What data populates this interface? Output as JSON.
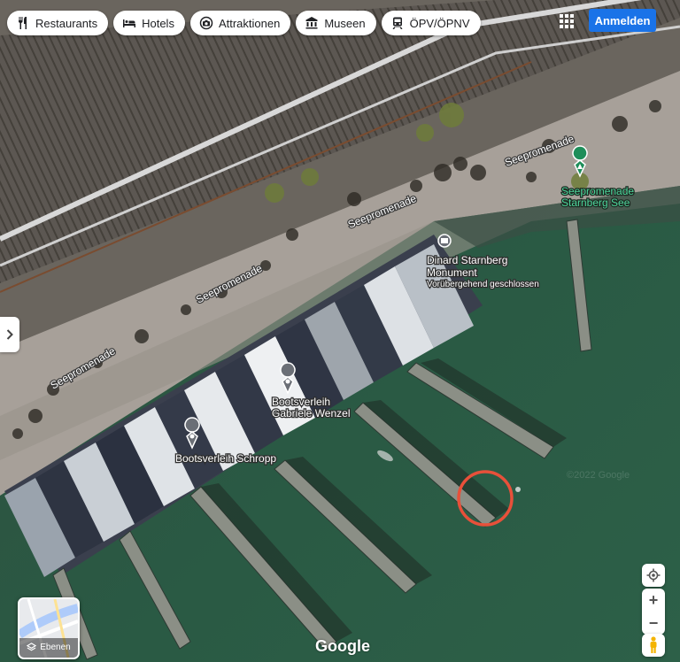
{
  "chips": [
    {
      "label": "Restaurants",
      "icon": "fork-knife-icon"
    },
    {
      "label": "Hotels",
      "icon": "bed-icon"
    },
    {
      "label": "Attraktionen",
      "icon": "camera-icon"
    },
    {
      "label": "Museen",
      "icon": "museum-icon"
    },
    {
      "label": "ÖPV/ÖPNV",
      "icon": "train-icon"
    }
  ],
  "header": {
    "apps_icon": "apps-grid-icon",
    "sign_in_label": "Anmelden",
    "accent_color": "#1a73e8"
  },
  "map": {
    "street_labels": [
      "Seepromenade",
      "Seepromenade",
      "Seepromenade",
      "Seepromenade"
    ],
    "pois": [
      {
        "name": "Dinard Starnberg Monument",
        "name_line1": "Dinard Starnberg",
        "name_line2": "Monument",
        "status": "Vorübergehend geschlossen",
        "icon": "monument-icon"
      },
      {
        "name": "Bootsverleih Gabriele Wenzel",
        "name_line1": "Bootsverleih",
        "name_line2": "Gabriele Wenzel",
        "icon": "location-pin-icon"
      },
      {
        "name": "Bootsverleih Schropp",
        "icon": "location-pin-icon"
      },
      {
        "name": "Seepromenade Starnberg See",
        "name_line1": "Seepromenade",
        "name_line2": "Starnberg See",
        "icon": "park-icon",
        "color": "#4fd39b"
      }
    ],
    "highlight_circle_color": "#e8503a",
    "imagery_watermark": "©2022 Google"
  },
  "controls": {
    "layers_label": "Ebenen",
    "zoom_in": "+",
    "zoom_out": "−",
    "locate_icon": "my-location-icon",
    "pegman_icon": "pegman-icon"
  },
  "branding": {
    "logo": "Google"
  }
}
